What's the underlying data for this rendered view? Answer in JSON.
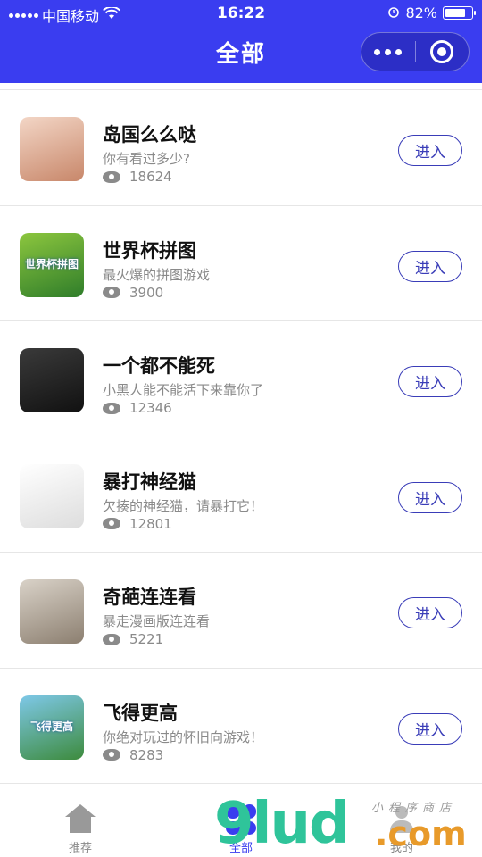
{
  "status_bar": {
    "carrier": "中国移动",
    "time": "16:22",
    "battery": "82%",
    "battery_level": 0.82
  },
  "header": {
    "title": "全部"
  },
  "games": [
    {
      "name": "岛国么么哒",
      "desc": "你有看过多少?",
      "views": "18624",
      "button": "进入",
      "thumb_colors": [
        "#f3d6c6",
        "#c8876a"
      ]
    },
    {
      "name": "世界杯拼图",
      "desc": "最火爆的拼图游戏",
      "views": "3900",
      "button": "进入",
      "thumb_colors": [
        "#8cc63e",
        "#2f7d2a"
      ],
      "thumb_text": "世界杯拼图"
    },
    {
      "name": "一个都不能死",
      "desc": "小黑人能不能活下来靠你了",
      "views": "12346",
      "button": "进入",
      "thumb_colors": [
        "#3a3a3a",
        "#111111"
      ]
    },
    {
      "name": "暴打神经猫",
      "desc": "欠揍的神经猫，请暴打它！",
      "views": "12801",
      "button": "进入",
      "thumb_colors": [
        "#ffffff",
        "#dddddd"
      ]
    },
    {
      "name": "奇葩连连看",
      "desc": "暴走漫画版连连看",
      "views": "5221",
      "button": "进入",
      "thumb_colors": [
        "#d9d2c8",
        "#8c7f70"
      ]
    },
    {
      "name": "飞得更高",
      "desc": "你绝对玩过的怀旧向游戏！",
      "views": "8283",
      "button": "进入",
      "thumb_colors": [
        "#7ec8e8",
        "#3d8b3d"
      ],
      "thumb_text": "飞得更高"
    }
  ],
  "tabbar": {
    "items": [
      {
        "label": "推荐",
        "icon": "home-icon",
        "active": false
      },
      {
        "label": "全部",
        "icon": "grid-icon",
        "active": true
      },
      {
        "label": "我的",
        "icon": "person-icon",
        "active": false
      }
    ]
  },
  "watermark": {
    "big": "9lud",
    "com": ".com",
    "cn": "小程序商店"
  },
  "colors": {
    "accent": "#3a3df0",
    "button_border": "#3a3db8",
    "muted": "#8a8a8a"
  }
}
